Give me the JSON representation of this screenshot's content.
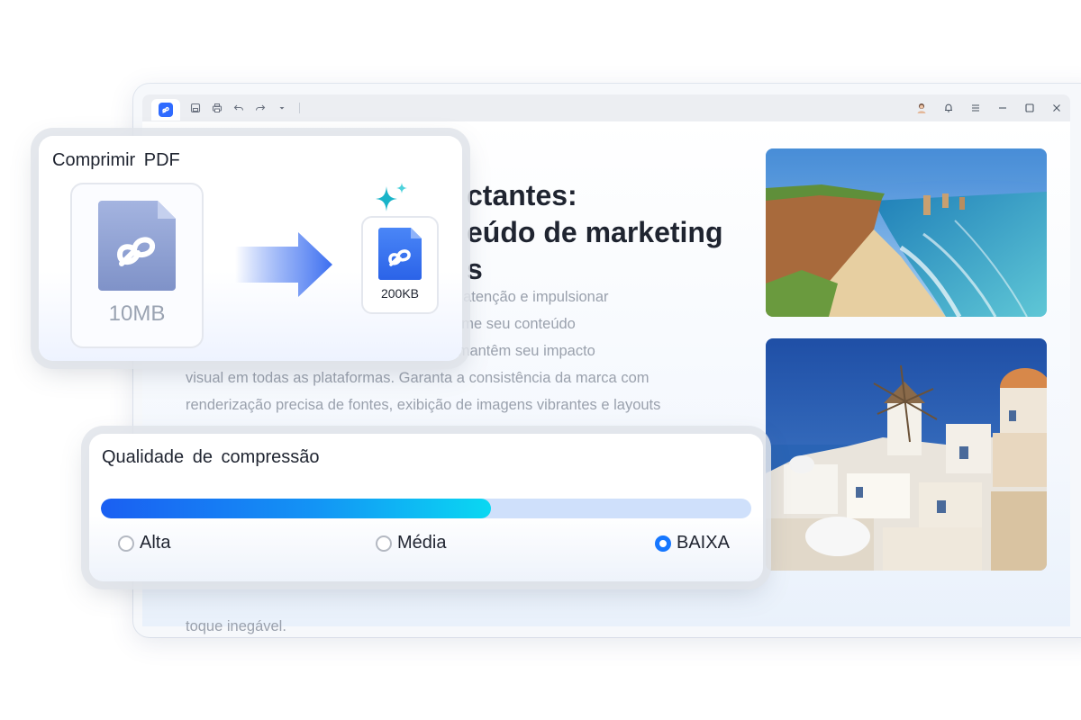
{
  "document": {
    "title_lines": [
      "ctantes:",
      "eúdo de marketing",
      "s"
    ],
    "body_lines": [
      "                                           para chamar a atenção e impulsionar",
      "                                           e você transforme seu conteúdo",
      "                                           refinados que mantêm seu impacto",
      "visual em todas as plataformas. Garanta a consistência da marca com",
      "renderização precisa de fontes, exibição de imagens vibrantes e layouts"
    ],
    "tail_text": "toque inegável."
  },
  "compress_card": {
    "title": "Comprimir  PDF",
    "source_size": "10MB",
    "result_size": "200KB"
  },
  "quality_card": {
    "title": "Qualidade  de  compressão",
    "level": 0.6,
    "options": [
      "Alta",
      "Média",
      "BAIXA"
    ],
    "selected": "BAIXA"
  },
  "colors": {
    "accent": "#1677ff",
    "slider_start": "#1a5ff2",
    "slider_end": "#0ad8f2",
    "slider_track": "#cfe0fb"
  },
  "icons": {
    "toolbar": [
      "app-logo-icon",
      "save-icon",
      "print-icon",
      "undo-icon",
      "redo-icon",
      "dropdown-icon"
    ],
    "window": [
      "avatar-icon",
      "bell-icon",
      "menu-icon",
      "minimize-icon",
      "maximize-icon",
      "close-icon"
    ]
  }
}
